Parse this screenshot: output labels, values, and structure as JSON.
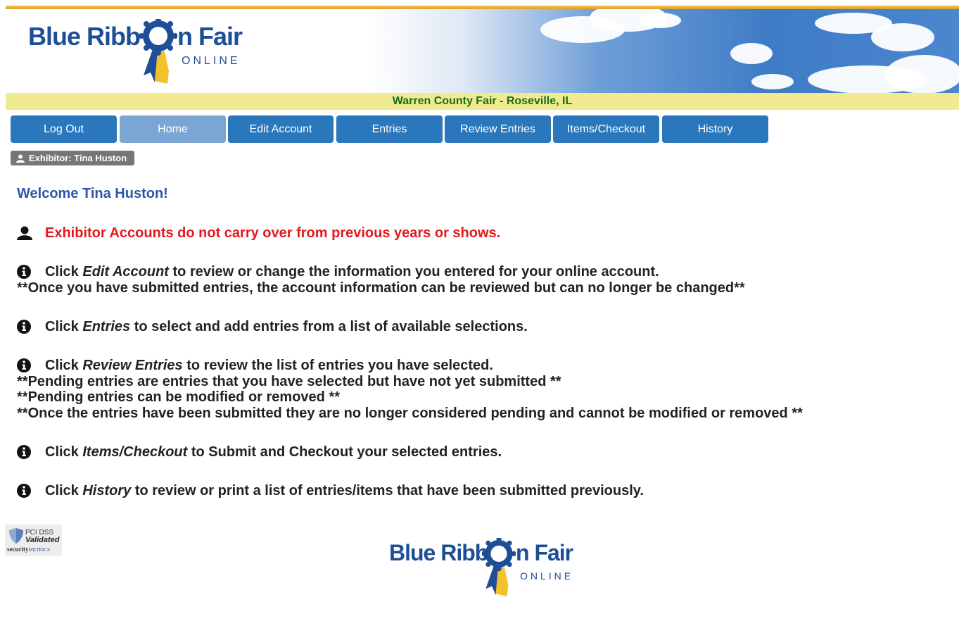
{
  "header": {
    "logo_word_1": "Blue Ribb",
    "logo_word_2": "n Fair",
    "logo_online": "ONLINE",
    "fair_title": "Warren County Fair - Roseville, IL"
  },
  "nav": {
    "items": [
      {
        "label": "Log Out"
      },
      {
        "label": "Home"
      },
      {
        "label": "Edit Account"
      },
      {
        "label": "Entries"
      },
      {
        "label": "Review Entries"
      },
      {
        "label": "Items/Checkout"
      },
      {
        "label": "History"
      }
    ],
    "active": "Home"
  },
  "exhibitor": {
    "label": "Exhibitor: Tina Huston"
  },
  "main": {
    "welcome": "Welcome Tina Huston!",
    "warning": "Exhibitor Accounts do not carry over from previous years or shows.",
    "edit_account": {
      "pre": "Click ",
      "em": "Edit Account",
      "post": " to review or change the information you entered for your online account.",
      "note": "**Once you have submitted entries, the account information can be reviewed but can no longer be changed**"
    },
    "entries": {
      "pre": "Click ",
      "em": "Entries",
      "post": " to select and add entries from a list of available selections."
    },
    "review_entries": {
      "pre": "Click ",
      "em": "Review Entries",
      "post": " to review the list of entries you have selected.",
      "note1": "**Pending entries are entries that you have selected but have not yet submitted **",
      "note2": "**Pending entries can be modified or removed **",
      "note3": "**Once the entries have been submitted they are no longer considered pending and cannot be modified or removed **"
    },
    "checkout": {
      "pre": "Click ",
      "em": "Items/Checkout",
      "post": " to Submit and Checkout your selected entries."
    },
    "history": {
      "pre": "Click ",
      "em": "History",
      "post": " to review or print a list of entries/items that have been submitted previously."
    }
  },
  "footer": {
    "pci_line1": "PCI DSS",
    "pci_line2": "Validated",
    "pci_brand_a": "security",
    "pci_brand_b": "METRICS"
  },
  "colors": {
    "nav_button": "#2a77bc",
    "nav_active": "#7ba6d3",
    "fair_bar": "#f0eb8e",
    "fair_text": "#1d6a1d",
    "welcome": "#2f55a8",
    "warning": "#e3191c"
  }
}
